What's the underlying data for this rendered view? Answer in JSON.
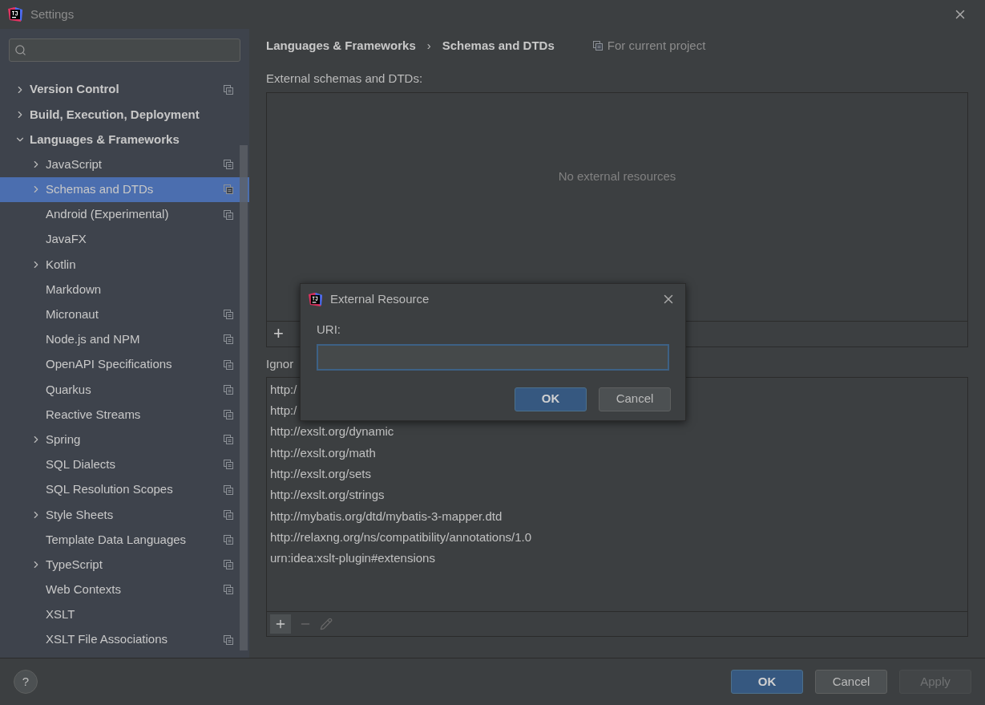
{
  "window": {
    "title": "Settings"
  },
  "sidebar": {
    "items": [
      {
        "label": "Version Control",
        "kind": "folder",
        "expanded": false,
        "selected": false,
        "project_scope": true,
        "bold": true
      },
      {
        "label": "Build, Execution, Deployment",
        "kind": "folder",
        "expanded": false,
        "selected": false,
        "project_scope": false,
        "bold": true
      },
      {
        "label": "Languages & Frameworks",
        "kind": "folder",
        "expanded": true,
        "selected": false,
        "project_scope": false,
        "bold": true,
        "children": [
          {
            "label": "JavaScript",
            "kind": "folder",
            "expanded": false,
            "selected": false,
            "project_scope": true,
            "bold": false
          },
          {
            "label": "Schemas and DTDs",
            "kind": "folder",
            "expanded": false,
            "selected": true,
            "project_scope": true,
            "bold": false
          },
          {
            "label": "Android (Experimental)",
            "kind": "leaf",
            "selected": false,
            "project_scope": true,
            "bold": false
          },
          {
            "label": "JavaFX",
            "kind": "leaf",
            "selected": false,
            "project_scope": false,
            "bold": false
          },
          {
            "label": "Kotlin",
            "kind": "folder",
            "expanded": false,
            "selected": false,
            "project_scope": false,
            "bold": false
          },
          {
            "label": "Markdown",
            "kind": "leaf",
            "selected": false,
            "project_scope": false,
            "bold": false
          },
          {
            "label": "Micronaut",
            "kind": "leaf",
            "selected": false,
            "project_scope": true,
            "bold": false
          },
          {
            "label": "Node.js and NPM",
            "kind": "leaf",
            "selected": false,
            "project_scope": true,
            "bold": false
          },
          {
            "label": "OpenAPI Specifications",
            "kind": "leaf",
            "selected": false,
            "project_scope": true,
            "bold": false
          },
          {
            "label": "Quarkus",
            "kind": "leaf",
            "selected": false,
            "project_scope": true,
            "bold": false
          },
          {
            "label": "Reactive Streams",
            "kind": "leaf",
            "selected": false,
            "project_scope": true,
            "bold": false
          },
          {
            "label": "Spring",
            "kind": "folder",
            "expanded": false,
            "selected": false,
            "project_scope": true,
            "bold": false
          },
          {
            "label": "SQL Dialects",
            "kind": "leaf",
            "selected": false,
            "project_scope": true,
            "bold": false
          },
          {
            "label": "SQL Resolution Scopes",
            "kind": "leaf",
            "selected": false,
            "project_scope": true,
            "bold": false
          },
          {
            "label": "Style Sheets",
            "kind": "folder",
            "expanded": false,
            "selected": false,
            "project_scope": true,
            "bold": false
          },
          {
            "label": "Template Data Languages",
            "kind": "leaf",
            "selected": false,
            "project_scope": true,
            "bold": false
          },
          {
            "label": "TypeScript",
            "kind": "folder",
            "expanded": false,
            "selected": false,
            "project_scope": true,
            "bold": false
          },
          {
            "label": "Web Contexts",
            "kind": "leaf",
            "selected": false,
            "project_scope": true,
            "bold": false
          },
          {
            "label": "XSLT",
            "kind": "leaf",
            "selected": false,
            "project_scope": false,
            "bold": false
          },
          {
            "label": "XSLT File Associations",
            "kind": "leaf",
            "selected": false,
            "project_scope": true,
            "bold": false
          }
        ]
      }
    ]
  },
  "breadcrumb": [
    "Languages & Frameworks",
    "Schemas and DTDs"
  ],
  "breadcrumb_separator": "›",
  "scope_note": "For current project",
  "external": {
    "label": "External schemas and DTDs:",
    "empty_text": "No external resources",
    "add": "+"
  },
  "ignored": {
    "label": "Ignor",
    "items": [
      "http:/",
      "http:/",
      "http://exslt.org/dynamic",
      "http://exslt.org/math",
      "http://exslt.org/sets",
      "http://exslt.org/strings",
      "http://mybatis.org/dtd/mybatis-3-mapper.dtd",
      "http://relaxng.org/ns/compatibility/annotations/1.0",
      "urn:idea:xslt-plugin#extensions"
    ]
  },
  "dialog": {
    "title": "External Resource",
    "field_label": "URI:",
    "buttons": [
      {
        "label": "OK",
        "primary": true
      },
      {
        "label": "Cancel",
        "primary": false
      }
    ]
  },
  "help": "?",
  "buttons": [
    {
      "label": "OK",
      "primary": true,
      "disabled": false
    },
    {
      "label": "Cancel",
      "primary": false,
      "disabled": false
    },
    {
      "label": "Apply",
      "primary": false,
      "disabled": true
    }
  ]
}
